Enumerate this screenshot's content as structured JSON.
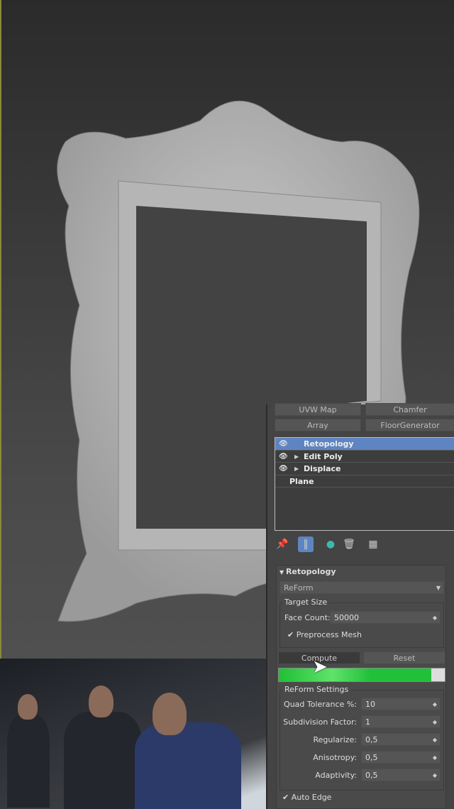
{
  "modifier_buttons": [
    {
      "label": "UVW Map"
    },
    {
      "label": "Chamfer"
    },
    {
      "label": "Array"
    },
    {
      "label": "FloorGenerator"
    }
  ],
  "stack": [
    {
      "label": "Retopology",
      "eye": true,
      "expand": false,
      "selected": true
    },
    {
      "label": "Edit Poly",
      "eye": true,
      "expand": true
    },
    {
      "label": "Displace",
      "eye": true,
      "expand": true
    },
    {
      "label": "Plane",
      "eye": false,
      "expand": false
    }
  ],
  "rollout": {
    "title": "Retopology",
    "method": "ReForm",
    "target_size": {
      "title": "Target Size",
      "face_count_label": "Face Count:",
      "face_count": "50000",
      "preprocess_label": "Preprocess Mesh",
      "preprocess_checked": true
    },
    "compute_label": "Compute",
    "reset_label": "Reset",
    "progress_percent": 92,
    "settings": {
      "title": "ReForm Settings",
      "fields": [
        {
          "label": "Quad Tolerance %:",
          "value": "10"
        },
        {
          "label": "Subdivision Factor:",
          "value": "1"
        },
        {
          "label": "Regularize:",
          "value": "0,5"
        },
        {
          "label": "Anisotropy:",
          "value": "0,5"
        },
        {
          "label": "Adaptivity:",
          "value": "0,5"
        }
      ]
    },
    "auto_edge_label": "Auto Edge",
    "auto_edge_checked": true
  },
  "colors": {
    "selection": "#5e85c1",
    "progress": "#22c03a"
  }
}
